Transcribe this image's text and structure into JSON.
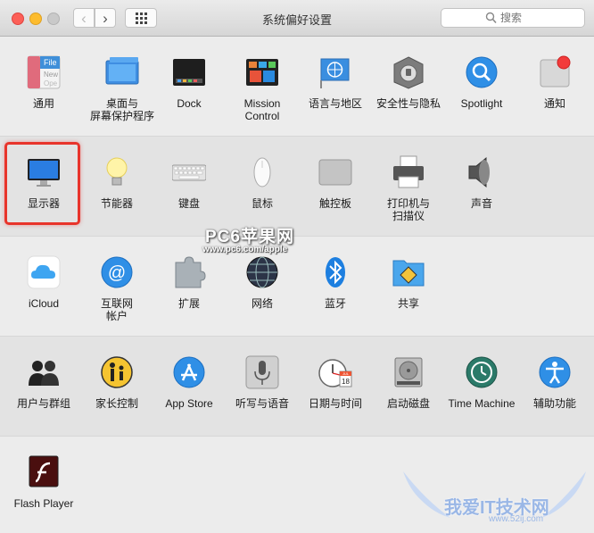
{
  "window": {
    "title": "系统偏好设置"
  },
  "toolbar": {
    "back_label": "‹",
    "forward_label": "›"
  },
  "search": {
    "placeholder": "搜索"
  },
  "rows": [
    {
      "panes": [
        {
          "label": "通用",
          "icon": "general-icon"
        },
        {
          "label": "桌面与\n屏幕保护程序",
          "icon": "desktop-screensaver-icon"
        },
        {
          "label": "Dock",
          "icon": "dock-icon"
        },
        {
          "label": "Mission\nControl",
          "icon": "mission-control-icon"
        },
        {
          "label": "语言与地区",
          "icon": "language-region-icon"
        },
        {
          "label": "安全性与隐私",
          "icon": "security-privacy-icon"
        },
        {
          "label": "Spotlight",
          "icon": "spotlight-icon"
        },
        {
          "label": "通知",
          "icon": "notifications-icon"
        }
      ]
    },
    {
      "panes": [
        {
          "label": "显示器",
          "icon": "displays-icon"
        },
        {
          "label": "节能器",
          "icon": "energy-saver-icon"
        },
        {
          "label": "键盘",
          "icon": "keyboard-icon"
        },
        {
          "label": "鼠标",
          "icon": "mouse-icon"
        },
        {
          "label": "触控板",
          "icon": "trackpad-icon"
        },
        {
          "label": "打印机与\n扫描仪",
          "icon": "printers-scanners-icon"
        },
        {
          "label": "声音",
          "icon": "sound-icon"
        }
      ]
    },
    {
      "panes": [
        {
          "label": "iCloud",
          "icon": "icloud-icon"
        },
        {
          "label": "互联网\n帐户",
          "icon": "internet-accounts-icon"
        },
        {
          "label": "扩展",
          "icon": "extensions-icon"
        },
        {
          "label": "网络",
          "icon": "network-icon"
        },
        {
          "label": "蓝牙",
          "icon": "bluetooth-icon"
        },
        {
          "label": "共享",
          "icon": "sharing-icon"
        }
      ]
    },
    {
      "panes": [
        {
          "label": "用户与群组",
          "icon": "users-groups-icon"
        },
        {
          "label": "家长控制",
          "icon": "parental-controls-icon"
        },
        {
          "label": "App Store",
          "icon": "app-store-icon"
        },
        {
          "label": "听写与语音",
          "icon": "dictation-speech-icon"
        },
        {
          "label": "日期与时间",
          "icon": "date-time-icon"
        },
        {
          "label": "启动磁盘",
          "icon": "startup-disk-icon"
        },
        {
          "label": "Time Machine",
          "icon": "time-machine-icon"
        },
        {
          "label": "辅助功能",
          "icon": "accessibility-icon"
        }
      ]
    },
    {
      "panes": [
        {
          "label": "Flash Player",
          "icon": "flash-player-icon"
        }
      ]
    }
  ],
  "icon_text": {
    "general": "File",
    "general_2": "New",
    "general_3": "Ope",
    "calendar_day": "18",
    "calendar_month": "JUL"
  },
  "watermarks": {
    "pc6_title": "PC6苹果网",
    "pc6_url": "www.pc6.com/apple",
    "site_title": "我爱IT技术网",
    "site_url": "www.52ij.com"
  },
  "colors": {
    "highlight": "#e8342b",
    "accent_blue": "#1e88e5"
  }
}
